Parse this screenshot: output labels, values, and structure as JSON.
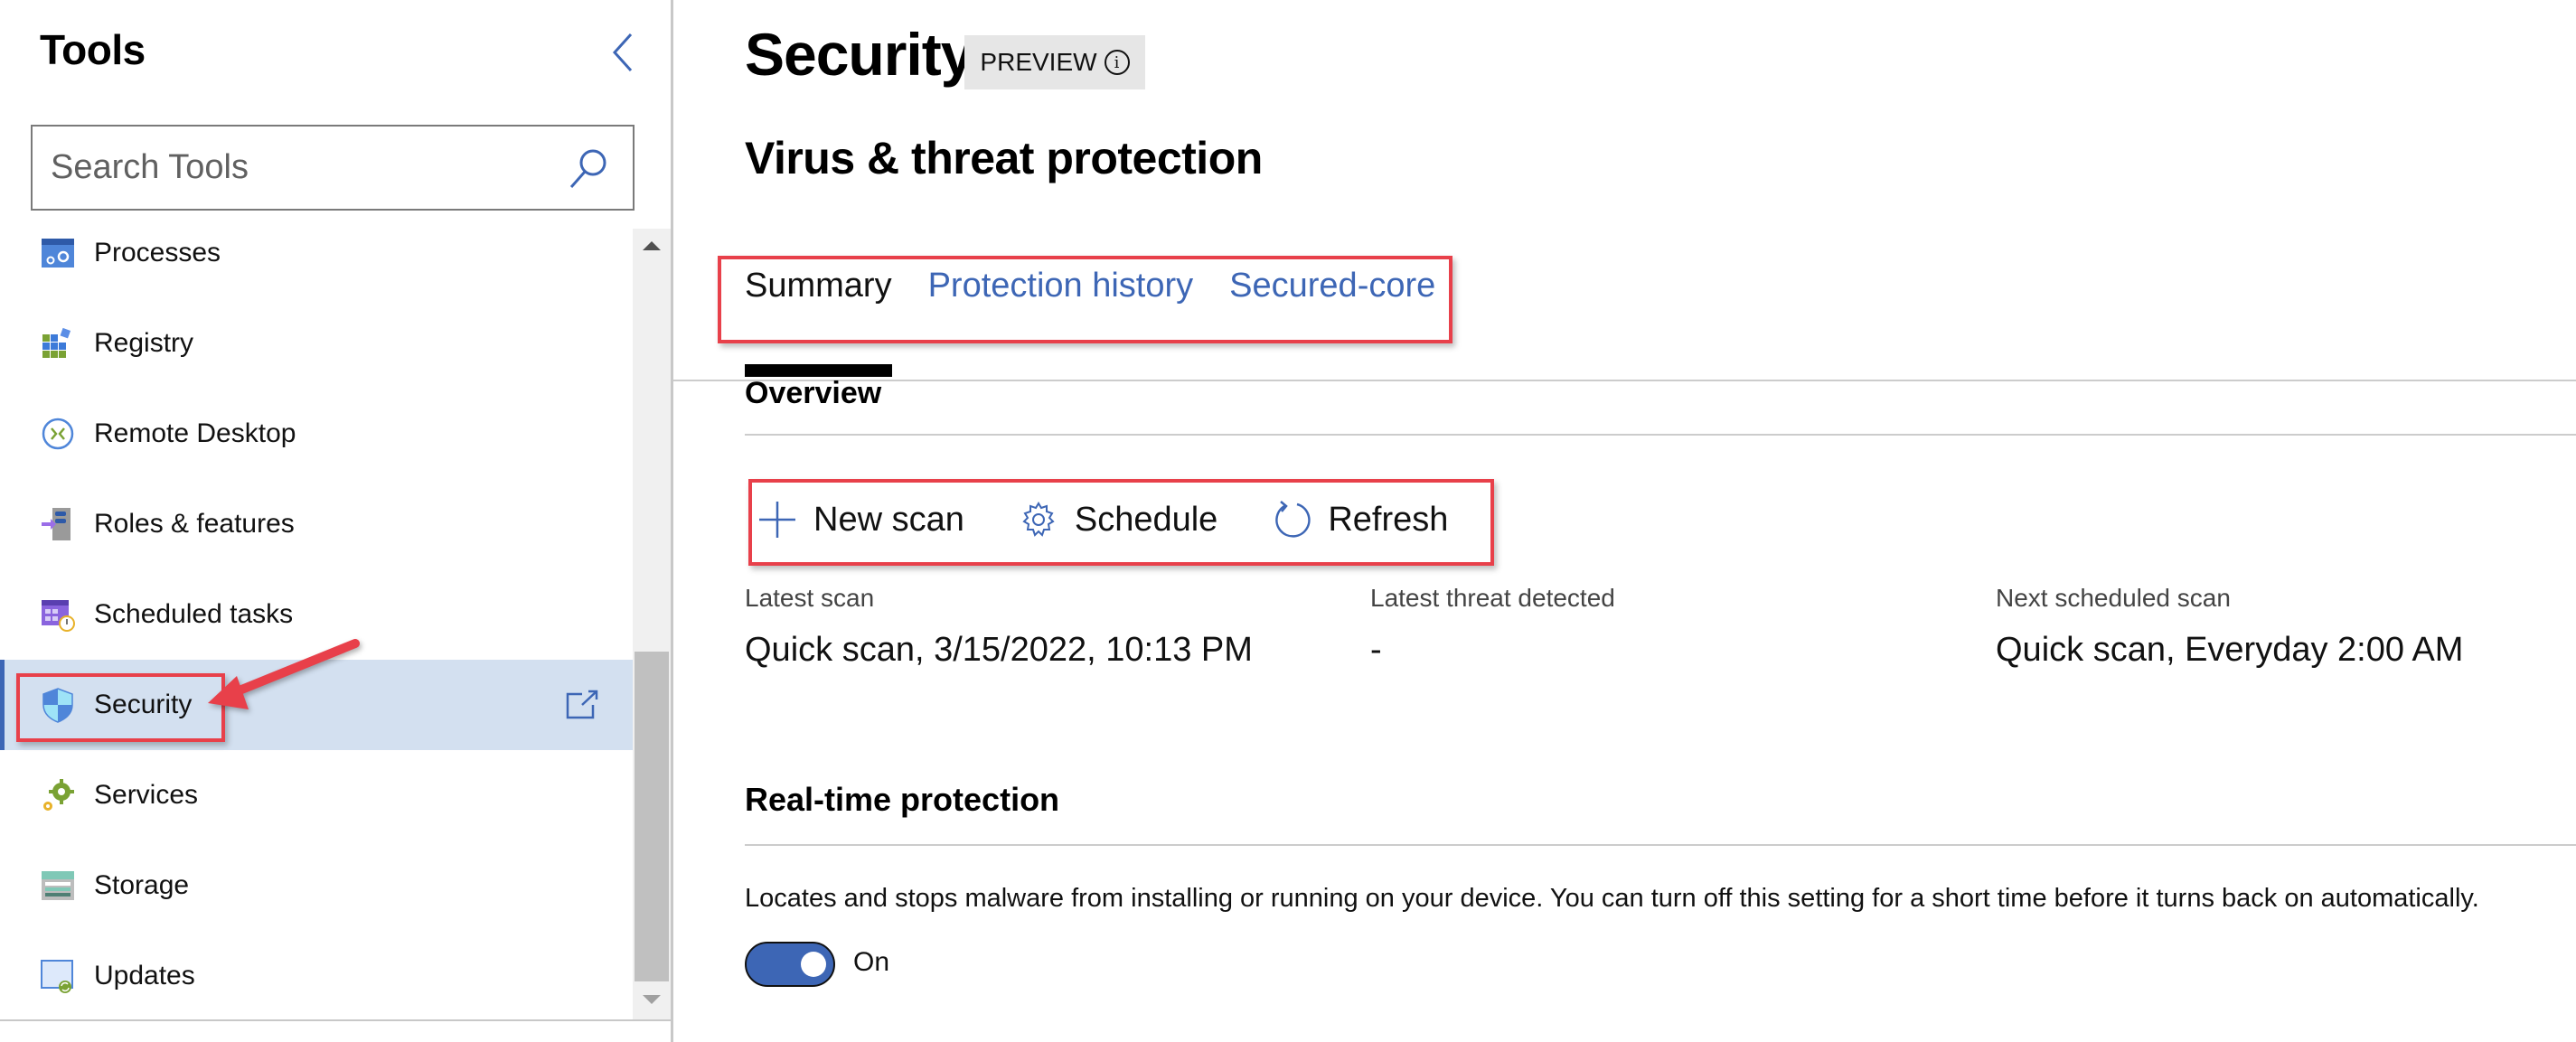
{
  "sidebar": {
    "title": "Tools",
    "collapse_icon": "chevron-left-icon",
    "search": {
      "placeholder": "Search Tools",
      "value": "",
      "icon": "search-icon"
    },
    "items": [
      {
        "label": "Processes",
        "icon": "processes-icon",
        "active": false
      },
      {
        "label": "Registry",
        "icon": "registry-icon",
        "active": false
      },
      {
        "label": "Remote Desktop",
        "icon": "remote-desktop-icon",
        "active": false
      },
      {
        "label": "Roles & features",
        "icon": "roles-features-icon",
        "active": false
      },
      {
        "label": "Scheduled tasks",
        "icon": "scheduled-tasks-icon",
        "active": false
      },
      {
        "label": "Security",
        "icon": "shield-icon",
        "active": true,
        "trailing_icon": "open-external-icon"
      },
      {
        "label": "Services",
        "icon": "services-gear-icon",
        "active": false
      },
      {
        "label": "Storage",
        "icon": "storage-icon",
        "active": false
      },
      {
        "label": "Updates",
        "icon": "updates-icon",
        "active": false
      }
    ]
  },
  "header": {
    "title": "Security",
    "badge": {
      "label": "PREVIEW",
      "icon": "info-icon"
    },
    "section_title": "Virus & threat protection"
  },
  "tabs": [
    {
      "label": "Summary",
      "active": true
    },
    {
      "label": "Protection history",
      "active": false
    },
    {
      "label": "Secured-core",
      "active": false
    }
  ],
  "overview": {
    "title": "Overview",
    "toolbar": [
      {
        "label": "New scan",
        "icon": "plus-icon"
      },
      {
        "label": "Schedule",
        "icon": "gear-icon"
      },
      {
        "label": "Refresh",
        "icon": "refresh-icon"
      }
    ],
    "info": [
      {
        "label": "Latest scan",
        "value": "Quick scan, 3/15/2022, 10:13 PM"
      },
      {
        "label": "Latest threat detected",
        "value": "-"
      },
      {
        "label": "Next scheduled scan",
        "value": "Quick scan, Everyday 2:00 AM"
      }
    ]
  },
  "realtime_protection": {
    "title": "Real-time protection",
    "description": "Locates and stops malware from installing or running on your device. You can turn off this setting for a short time before it turns back on automatically.",
    "toggle_on": true,
    "toggle_label": "On"
  },
  "colors": {
    "accent": "#3d66b5",
    "active_row": "#d3e0f0",
    "annotation": "#e8404a",
    "badge_bg": "#e6e6e6"
  }
}
